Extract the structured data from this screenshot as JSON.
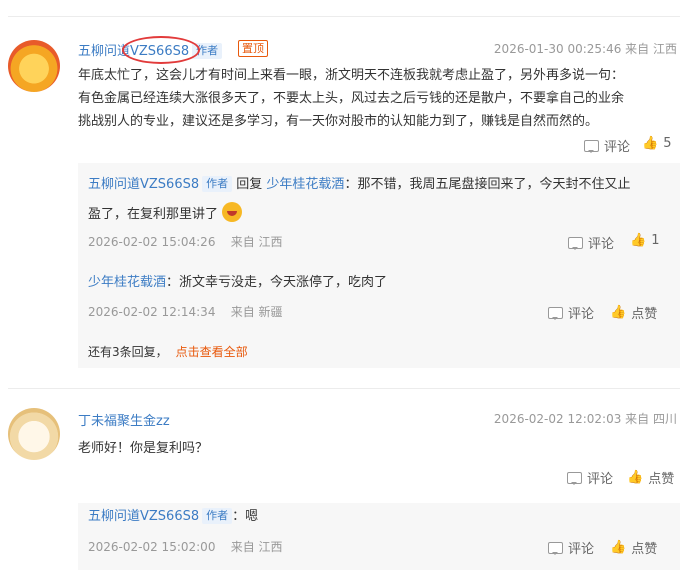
{
  "comments": [
    {
      "user": "五柳问道VZS66S8",
      "tag": "作者",
      "pinned": "置顶",
      "time_loc": "2026-01-30 00:25:46 来自 江西",
      "text_lines": [
        "年底太忙了，这会儿才有时间上来看一眼，浙文明天不连板我就考虑止盈了，另外再多说一句：",
        "有色金属已经连续大涨很多天了，不要太上头，风过去之后亏钱的还是散户，不要拿自己的业余",
        "挑战别人的专业，建议还是多学习，有一天你对股市的认知能力到了，赚钱是自然而然的。"
      ],
      "comment_label": "评论",
      "like_count": "5",
      "replies": [
        {
          "user": "五柳问道VZS66S8",
          "tag": "作者",
          "reply_word": "回复",
          "reply_to": "少年桂花载酒",
          "text_line1": "：那不错，我周五尾盘接回来了，今天封不住又止",
          "text_line2": "盈了，在复利那里讲了",
          "time": "2026-02-02 15:04:26",
          "loc": "来自 江西",
          "comment_label": "评论",
          "like_count": "1"
        },
        {
          "user": "少年桂花载酒",
          "text": "：浙文幸亏没走，今天涨停了，吃肉了",
          "time": "2026-02-02 12:14:34",
          "loc": "来自 新疆",
          "comment_label": "评论",
          "like_label": "点赞"
        }
      ],
      "more_text": "还有3条回复，",
      "more_link": "点击查看全部"
    },
    {
      "user": "丁未福聚生金zz",
      "time_loc": "2026-02-02 12:02:03 来自 四川",
      "text": "老师好！你是复利吗？",
      "comment_label": "评论",
      "like_label": "点赞",
      "replies": [
        {
          "user": "五柳问道VZS66S8",
          "tag": "作者",
          "text": "：嗯",
          "time": "2026-02-02 15:02:00",
          "loc": "来自 江西",
          "comment_label": "评论",
          "like_label": "点赞"
        }
      ]
    }
  ],
  "icons": {
    "comment": "comment-icon",
    "like": "thumbs-up-icon"
  },
  "colors": {
    "link": "#3c7cc4",
    "accent": "#e8590c",
    "highlight_circle": "#e23b3b"
  }
}
